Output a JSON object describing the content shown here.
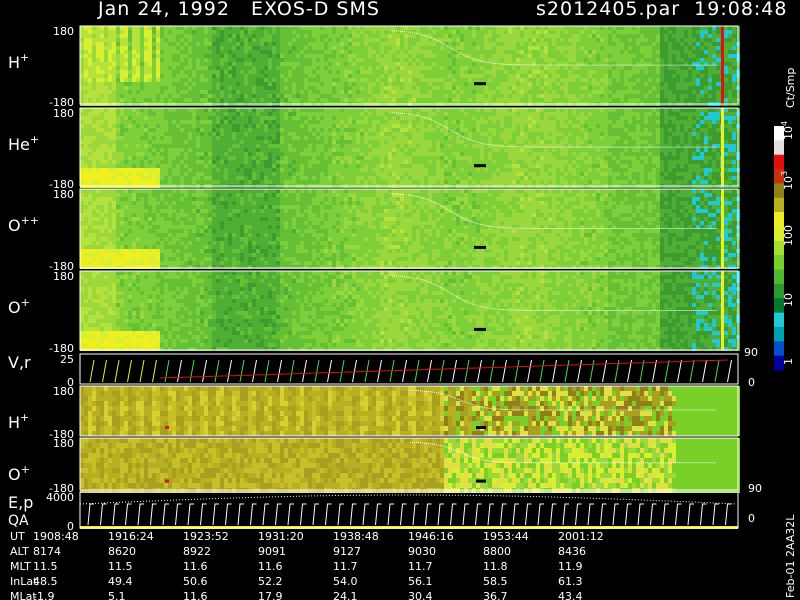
{
  "header": {
    "title_left": "Jan 24, 1992   EXOS-D SMS",
    "title_right": "s2012405.par  19:08:48"
  },
  "colors": {
    "background": "#000000",
    "axis": "#ffffff",
    "trace": "#ffffff",
    "highlight_red": "#e01010",
    "highlight_yellow": "#f0f020",
    "cyan": "#20c8d8"
  },
  "colorbar": {
    "unit": "Ct/Smp",
    "tick_labels": [
      "1",
      "10",
      "100",
      "10",
      "10"
    ],
    "tick_exponents": [
      "",
      "",
      "",
      "3",
      "4"
    ],
    "colors": [
      "#0000a0",
      "#0050d0",
      "#00a0b0",
      "#20c8d8",
      "#007830",
      "#2a9a30",
      "#50b830",
      "#78d028",
      "#a8e030",
      "#d8f030",
      "#f0f020",
      "#b8b020",
      "#908018",
      "#c83010",
      "#e01010",
      "#e0e0e0",
      "#ffffff"
    ]
  },
  "chart_data": {
    "type": "heatmap",
    "panels": [
      {
        "label": "H",
        "sup": "+",
        "ytop": "180",
        "ybot": "-180",
        "spike": "red",
        "style": "green"
      },
      {
        "label": "He",
        "sup": "+",
        "ytop": "180",
        "ybot": "-180",
        "spike": "yellow",
        "style": "green"
      },
      {
        "label": "O",
        "sup": "++",
        "ytop": "180",
        "ybot": "-180",
        "spike": "yellow",
        "style": "green"
      },
      {
        "label": "O",
        "sup": "+",
        "ytop": "180",
        "ybot": "-180",
        "spike": "yellow",
        "style": "green"
      },
      {
        "label": "V,r",
        "sup": "",
        "ytop": "25",
        "ybot": "0",
        "right_top": "90",
        "right_bot": "0",
        "style": "lines"
      },
      {
        "label": "H",
        "sup": "+",
        "ytop": "180",
        "ybot": "-180",
        "style": "olive"
      },
      {
        "label": "O",
        "sup": "+",
        "ytop": "180",
        "ybot": "-180",
        "right_bot": "90",
        "style": "olive2"
      },
      {
        "label": "E,p",
        "sup": "",
        "label2": "QA",
        "ytop": "4000",
        "ybot": "0",
        "right_bot": "0",
        "style": "ep"
      }
    ],
    "ephemeris": {
      "row_labels": [
        "UT",
        "ALT",
        "MLT",
        "InLat",
        "MLat"
      ],
      "columns": [
        [
          "1908:48",
          "8174",
          "11.5",
          "48.5",
          "-1.9"
        ],
        [
          "1916:24",
          "8620",
          "11.5",
          "49.4",
          "5.1"
        ],
        [
          "1923:52",
          "8922",
          "11.6",
          "50.6",
          "11.6"
        ],
        [
          "1931:20",
          "9091",
          "11.6",
          "52.2",
          "17.9"
        ],
        [
          "1938:48",
          "9127",
          "11.7",
          "54.0",
          "24.1"
        ],
        [
          "1946:16",
          "9030",
          "11.7",
          "56.1",
          "30.4"
        ],
        [
          "1953:44",
          "8800",
          "11.8",
          "58.5",
          "36.7"
        ],
        [
          "2001:12",
          "8436",
          "11.9",
          "61.3",
          "43.4"
        ]
      ]
    },
    "side_text": "Feb-01 2AA32L"
  }
}
